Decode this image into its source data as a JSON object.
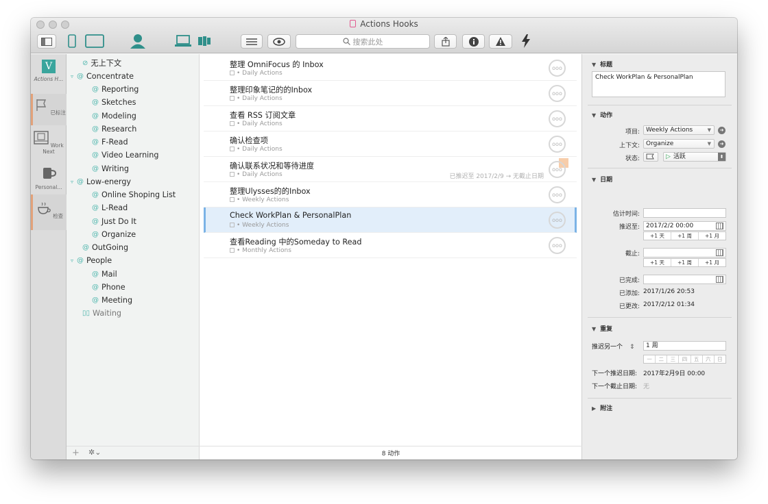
{
  "window": {
    "title": "Actions Hooks"
  },
  "toolbar": {
    "search_placeholder": "搜索此处"
  },
  "perspectives": [
    {
      "icon": "v-logo-icon",
      "label": "Actions H..."
    },
    {
      "icon": "flag-icon",
      "label": "已标注"
    },
    {
      "icon": "work-next-icon",
      "label": "Work Next"
    },
    {
      "icon": "mug-icon",
      "label": "Personal..."
    },
    {
      "icon": "coffee-icon",
      "label": "检查"
    }
  ],
  "sidebar": {
    "items": [
      {
        "label": "无上下文",
        "indent": 1,
        "glyph": "⊘",
        "disc": ""
      },
      {
        "label": "Concentrate",
        "indent": 0,
        "glyph": "@",
        "disc": "▿"
      },
      {
        "label": "Reporting",
        "indent": 2,
        "glyph": "@",
        "disc": ""
      },
      {
        "label": "Sketches",
        "indent": 2,
        "glyph": "@",
        "disc": ""
      },
      {
        "label": "Modeling",
        "indent": 2,
        "glyph": "@",
        "disc": ""
      },
      {
        "label": "Research",
        "indent": 2,
        "glyph": "@",
        "disc": ""
      },
      {
        "label": "F-Read",
        "indent": 2,
        "glyph": "@",
        "disc": ""
      },
      {
        "label": "Video Learning",
        "indent": 2,
        "glyph": "@",
        "disc": ""
      },
      {
        "label": "Writing",
        "indent": 2,
        "glyph": "@",
        "disc": ""
      },
      {
        "label": "Low-energy",
        "indent": 0,
        "glyph": "@",
        "disc": "▿"
      },
      {
        "label": "Online Shoping List",
        "indent": 2,
        "glyph": "@",
        "disc": ""
      },
      {
        "label": "L-Read",
        "indent": 2,
        "glyph": "@",
        "disc": ""
      },
      {
        "label": "Just Do It",
        "indent": 2,
        "glyph": "@",
        "disc": ""
      },
      {
        "label": "Organize",
        "indent": 2,
        "glyph": "@",
        "disc": ""
      },
      {
        "label": "OutGoing",
        "indent": 1,
        "glyph": "@",
        "disc": ""
      },
      {
        "label": "People",
        "indent": 0,
        "glyph": "@",
        "disc": "▿"
      },
      {
        "label": "Mail",
        "indent": 2,
        "glyph": "@",
        "disc": ""
      },
      {
        "label": "Phone",
        "indent": 2,
        "glyph": "@",
        "disc": ""
      },
      {
        "label": "Meeting",
        "indent": 2,
        "glyph": "@",
        "disc": ""
      },
      {
        "label": "Waiting",
        "indent": 1,
        "glyph": "▯▯",
        "disc": ""
      }
    ],
    "footer": {
      "add": "+",
      "gear": "✲⌄"
    }
  },
  "tasks": [
    {
      "title": "整理 OmniFocus 的 Inbox",
      "project": "• Daily Actions",
      "defer": "",
      "flag": false,
      "selected": false
    },
    {
      "title": "整理印象笔记的的Inbox",
      "project": "• Daily Actions",
      "defer": "",
      "flag": false,
      "selected": false
    },
    {
      "title": "查看 RSS 订阅文章",
      "project": "• Daily Actions",
      "defer": "",
      "flag": false,
      "selected": false
    },
    {
      "title": "确认检查项",
      "project": "• Daily Actions",
      "defer": "",
      "flag": false,
      "selected": false
    },
    {
      "title": "确认联系状况和等待进度",
      "project": "• Daily Actions",
      "defer": "已推迟至 2017/2/9 → 无截止日期",
      "flag": true,
      "selected": false
    },
    {
      "title": "整理Ulysses的的Inbox",
      "project": "• Weekly Actions",
      "defer": "",
      "flag": false,
      "selected": false
    },
    {
      "title": "Check WorkPlan & PersonalPlan",
      "project": "• Weekly Actions",
      "defer": "",
      "flag": false,
      "selected": true
    },
    {
      "title": "查看Reading 中的Someday to Read",
      "project": "• Monthly Actions",
      "defer": "",
      "flag": false,
      "selected": false
    }
  ],
  "task_circle_glyph": "ooo",
  "main_footer": "8 动作",
  "inspector": {
    "title_section": {
      "heading": "标题",
      "value": "Check WorkPlan & PersonalPlan"
    },
    "action_section": {
      "heading": "动作",
      "project_label": "项目:",
      "project_value": "Weekly Actions",
      "context_label": "上下文:",
      "context_value": "Organize",
      "status_label": "状态:",
      "status_value": "活跃"
    },
    "date_section": {
      "heading": "日期",
      "estimate_label": "估计时间:",
      "estimate_value": "",
      "defer_label": "推迟至:",
      "defer_value": "2017/2/2 00:00",
      "due_label": "截止:",
      "due_value": "",
      "completed_label": "已完成:",
      "completed_value": "",
      "added_label": "已添加:",
      "added_value": "2017/1/26 20:53",
      "modified_label": "已更改:",
      "modified_value": "2017/2/12 01:34",
      "shortcuts": [
        "+1 天",
        "+1 周",
        "+1 月"
      ]
    },
    "repeat_section": {
      "heading": "重复",
      "mode_label": "推迟另一个",
      "interval_value": "1 周",
      "weekdays": [
        "一",
        "二",
        "三",
        "四",
        "五",
        "六",
        "日"
      ],
      "next_defer_label": "下一个推迟日期:",
      "next_defer_value": "2017年2月9日 00:00",
      "next_due_label": "下一个截止日期:",
      "next_due_value": "无"
    },
    "notes_section": {
      "heading": "附注"
    }
  }
}
